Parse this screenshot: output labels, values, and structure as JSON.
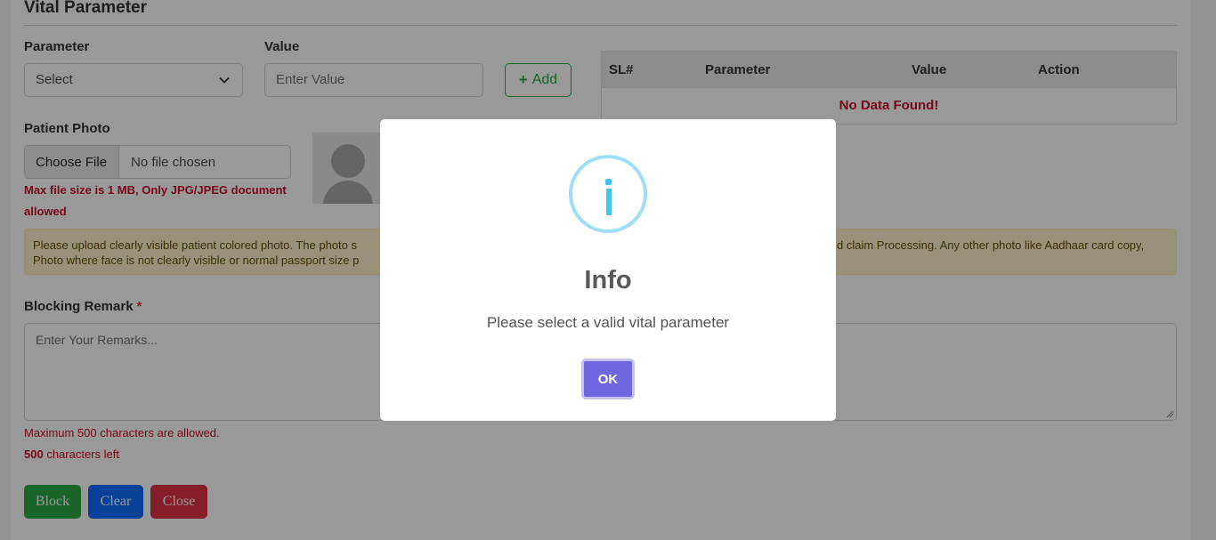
{
  "section": {
    "title": "Vital Parameter"
  },
  "vital": {
    "parameter_label": "Parameter",
    "parameter_value": "Select",
    "value_label": "Value",
    "value_placeholder": "Enter Value",
    "add_label": "Add"
  },
  "table": {
    "headers": [
      "SL#",
      "Parameter",
      "Value",
      "Action"
    ],
    "empty_message": "No Data Found!"
  },
  "photo": {
    "label": "Patient Photo",
    "choose_button": "Choose File",
    "chosen_text": "No file chosen",
    "size_error_line1": "Max file size is 1 MB, Only JPG/JPEG document",
    "size_error_line2": "allowed"
  },
  "alert": {
    "line1_left": "Please upload clearly visible patient colored photo. The photo s",
    "line1_right": "d claim Processing. Any other photo like Aadhaar card copy,",
    "line2_left": "Photo where face is not clearly visible or normal passport size p"
  },
  "remark": {
    "label": "Blocking Remark",
    "required_mark": "*",
    "placeholder": "Enter Your Remarks...",
    "max_message": "Maximum 500 characters are allowed.",
    "chars_left_count": "500",
    "chars_left_text": " characters left"
  },
  "actions": {
    "block": "Block",
    "clear": "Clear",
    "close": "Close"
  },
  "modal": {
    "title": "Info",
    "message": "Please select a valid vital parameter",
    "ok": "OK",
    "icon": "info-icon"
  },
  "colors": {
    "success": "#28a745",
    "primary": "#0d6efd",
    "danger": "#dc3545",
    "error_text": "#c8102e",
    "modal_button": "#7066e0",
    "info_icon": "#3fc3ee"
  }
}
